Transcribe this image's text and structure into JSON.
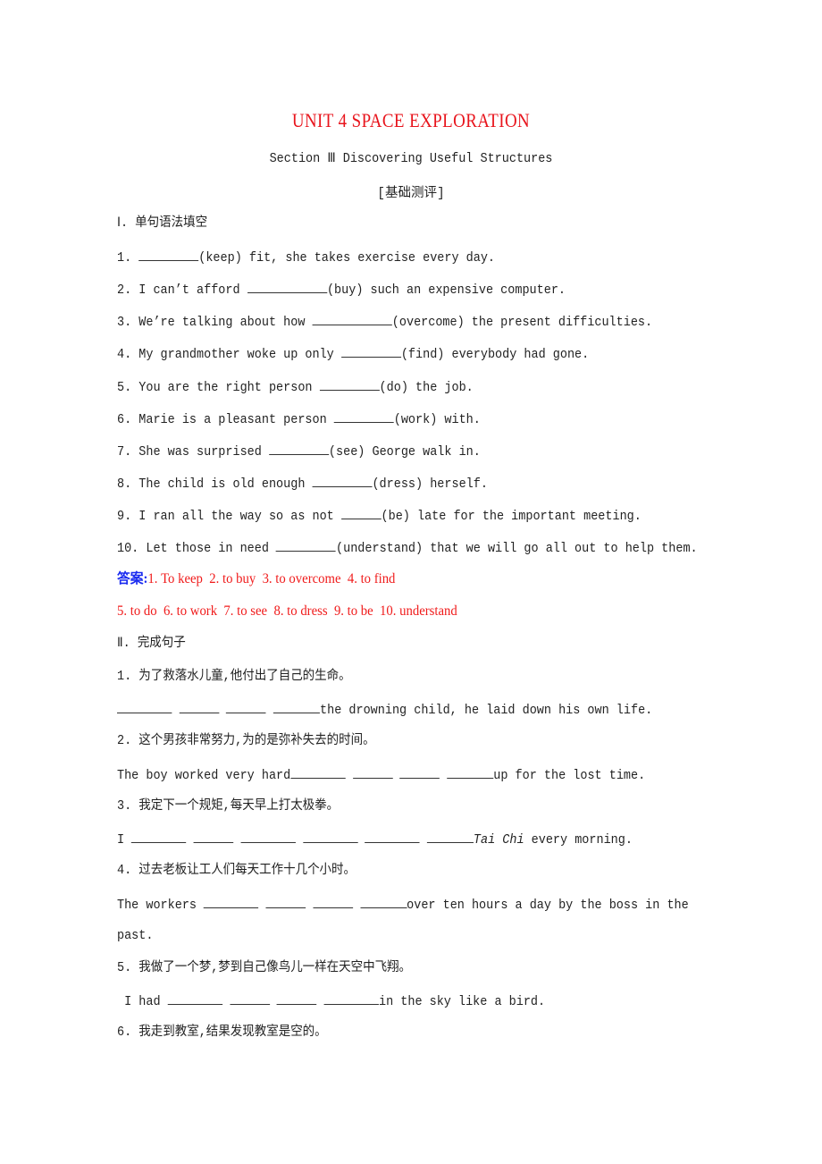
{
  "header": {
    "title": "UNIT 4 SPACE EXPLORATION",
    "subtitle": "Section Ⅲ  Discovering Useful Structures",
    "category_label": "[基础测评]"
  },
  "colors": {
    "title": "#e8141c",
    "answer_label": "#1a2bf0",
    "answer_text": "#f01a1a",
    "body_text": "#222222"
  },
  "part1": {
    "heading": "Ⅰ. 单句语法填空",
    "items": [
      {
        "num": "1.",
        "before": "",
        "hint": "(keep) fit, she takes exercise every day."
      },
      {
        "num": "2.",
        "before": "I can’t afford",
        "hint": "(buy) such an expensive computer."
      },
      {
        "num": "3.",
        "before": "We’re talking about how",
        "hint": "(overcome) the present difficulties."
      },
      {
        "num": "4.",
        "before": "My grandmother woke up only",
        "hint": "(find) everybody had gone."
      },
      {
        "num": "5.",
        "before": "You are the right person",
        "hint": "(do) the job."
      },
      {
        "num": "6.",
        "before": "Marie is a pleasant person",
        "hint": "(work) with."
      },
      {
        "num": "7.",
        "before": "She was surprised",
        "hint": "(see) George walk in."
      },
      {
        "num": "8.",
        "before": "The child is old enough",
        "hint": "(dress) herself."
      },
      {
        "num": "9.",
        "before": "I ran all the way so as not",
        "hint": "(be) late for the important meeting."
      },
      {
        "num": "10.",
        "before": "Let those in need",
        "hint": "(understand) that we will go all out to help them."
      }
    ],
    "answer_label": "答案:",
    "answers_line1": "1. To keep  2. to buy  3. to overcome  4. to find",
    "answers_line2": "5. to do  6. to work  7. to see  8. to dress  9. to be  10. understand"
  },
  "part2": {
    "heading": "Ⅱ. 完成句子",
    "items": [
      {
        "num": "1.",
        "chinese": "为了救落水儿童,他付出了自己的生命。",
        "en_before": "",
        "en_after": "the drowning child, he laid down his own life."
      },
      {
        "num": "2.",
        "chinese": "这个男孩非常努力,为的是弥补失去的时间。",
        "en_before": "The boy worked very hard",
        "en_after": "up for the lost time."
      },
      {
        "num": "3.",
        "chinese": "我定下一个规矩,每天早上打太极拳。",
        "en_before": "I",
        "en_italic": "Tai Chi",
        "en_after": " every morning."
      },
      {
        "num": "4.",
        "chinese": "过去老板让工人们每天工作十几个小时。",
        "en_before": "The workers",
        "en_after": "over ten hours a day by the boss in the",
        "en_continued": "past."
      },
      {
        "num": "5.",
        "chinese": "我做了一个梦,梦到自己像鸟儿一样在天空中飞翔。",
        "en_before": " I had",
        "en_after": "in the sky like a bird."
      },
      {
        "num": "6.",
        "chinese": "我走到教室,结果发现教室是空的。"
      }
    ]
  }
}
